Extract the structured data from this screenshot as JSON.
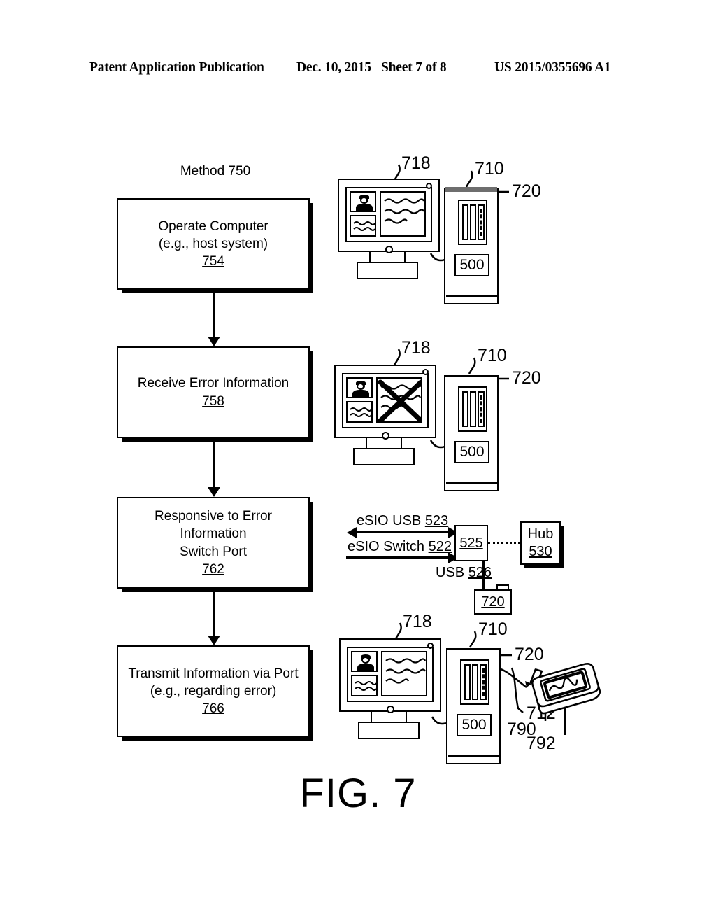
{
  "header": {
    "publication": "Patent Application Publication",
    "date": "Dec. 10, 2015",
    "sheet": "Sheet 7 of 8",
    "number": "US 2015/0355696 A1"
  },
  "figure": {
    "caption": "FIG. 7",
    "method_title_prefix": "Method ",
    "method_title_ref": "750"
  },
  "flow": {
    "steps": [
      {
        "line1": "Operate Computer",
        "line2": "(e.g., host system)",
        "ref": "754"
      },
      {
        "line1": "Receive Error Information",
        "line2": "",
        "ref": "758"
      },
      {
        "line1": "Responsive to Error Information",
        "line2": "Switch Port",
        "ref": "762"
      },
      {
        "line1": "Transmit Information via Port",
        "line2": "(e.g., regarding error)",
        "ref": "766"
      }
    ]
  },
  "illustrations": {
    "group1": {
      "monitor_ref": "718",
      "tower_ref": "710",
      "card_ref": "720",
      "tower_label": "500"
    },
    "group2": {
      "monitor_ref": "718",
      "tower_ref": "710",
      "card_ref": "720",
      "tower_label": "500",
      "error_mark": "x-cross"
    },
    "group3": {
      "esio_usb_label": "eSIO USB ",
      "esio_usb_ref": "523",
      "esio_switch_label": "eSIO Switch ",
      "esio_switch_ref": "522",
      "switch_box_ref": "525",
      "hub_label": "Hub",
      "hub_ref": "530",
      "usb_label": "USB ",
      "usb_ref": "526",
      "device_ref": "720"
    },
    "group4": {
      "monitor_ref": "718",
      "tower_ref": "710",
      "card_ref": "720",
      "tower_label": "500",
      "cable_ref": "712",
      "mobile_ref": "790",
      "mobile_screen_ref": "792"
    }
  },
  "colors": {
    "ink": "#000000",
    "paper": "#ffffff",
    "tower_cap": "#6e6e6e"
  }
}
